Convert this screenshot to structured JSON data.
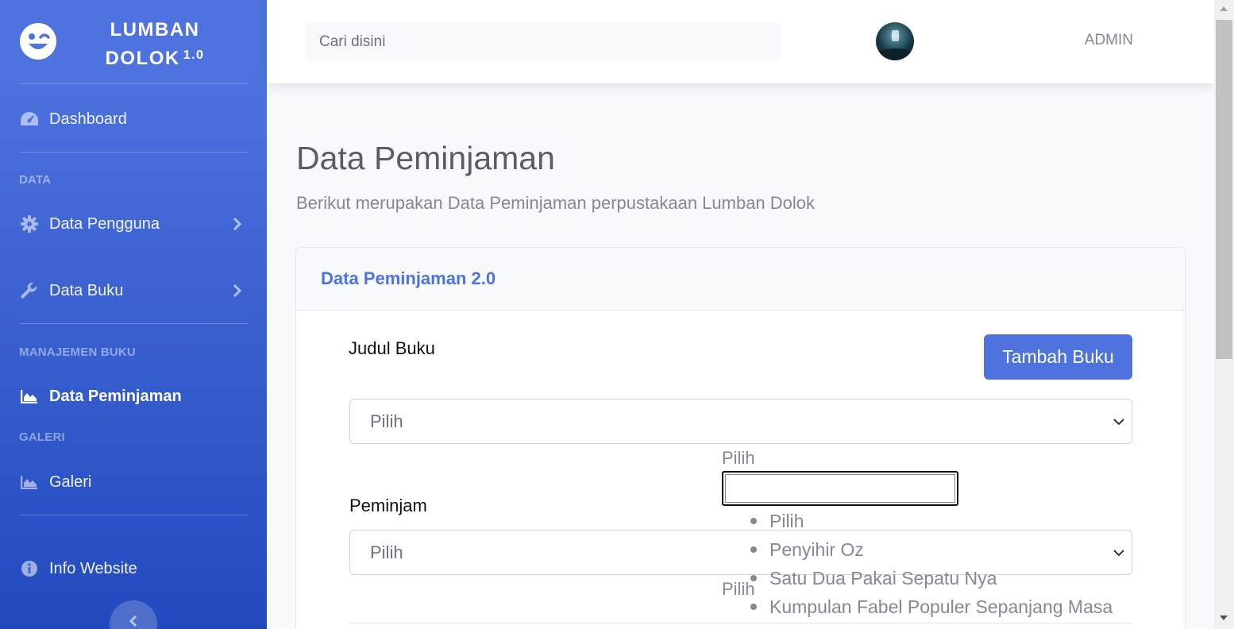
{
  "brand": {
    "line1": "LUMBAN",
    "line2": "DOLOK",
    "version": "1.0",
    "icon": "wink-face-icon"
  },
  "sidebar": {
    "dashboard": "Dashboard",
    "heading_data": "DATA",
    "data_pengguna": "Data Pengguna",
    "data_buku": "Data Buku",
    "heading_manajemen": "MANAJEMEN BUKU",
    "data_peminjaman": "Data Peminjaman",
    "heading_galeri": "GALERI",
    "galeri": "Galeri",
    "info_website": "Info Website"
  },
  "topbar": {
    "search_placeholder": "Cari disini",
    "user_name": "ADMIN"
  },
  "page": {
    "title": "Data Peminjaman",
    "subtitle": "Berikut merupakan Data Peminjaman perpustakaan Lumban Dolok"
  },
  "card": {
    "title": "Data Peminjaman 2.0",
    "judul_label": "Judul Buku",
    "add_button": "Tambah Buku",
    "judul_select_value": "Pilih",
    "peminjam_label": "Peminjam",
    "peminjam_select_value": "Pilih"
  },
  "overlay": {
    "top_text": "Pilih",
    "bottom_text": "Pilih",
    "options": [
      "Pilih",
      "Penyihir Oz",
      "Satu Dua Pakai Sepatu Nya",
      "Kumpulan Fabel Populer Sepanjang Masa"
    ]
  },
  "colors": {
    "primary": "#4e73df",
    "sidebar_start": "#4e73df",
    "sidebar_end": "#224abe",
    "text_gray": "#858796"
  }
}
